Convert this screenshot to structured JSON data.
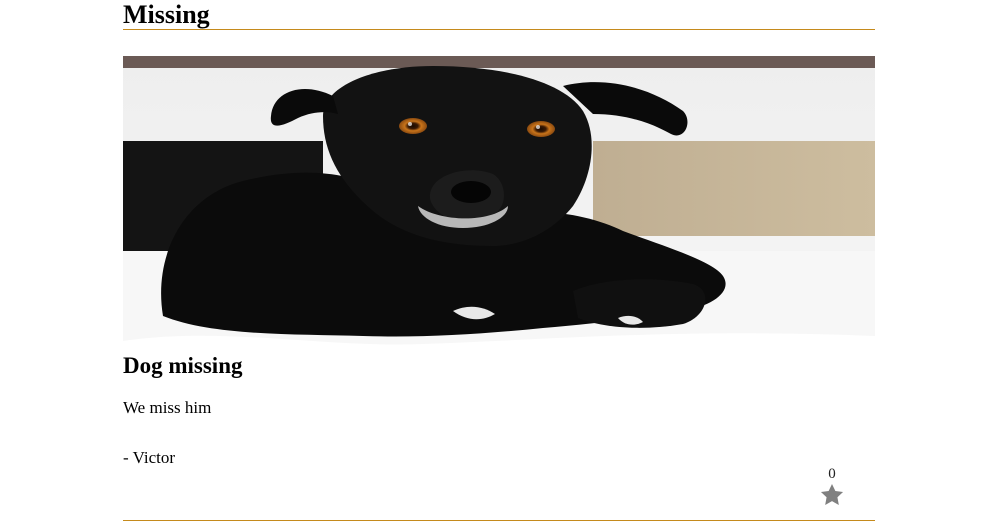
{
  "page": {
    "title": "Missing"
  },
  "post": {
    "image_alt": "black dog lying on white fur rug",
    "title": "Dog missing",
    "body": "We miss him",
    "author": "- Victor",
    "likes": "0",
    "like_icon": "star-icon"
  },
  "colors": {
    "rule": "#c58a1c",
    "star": "#808080"
  }
}
